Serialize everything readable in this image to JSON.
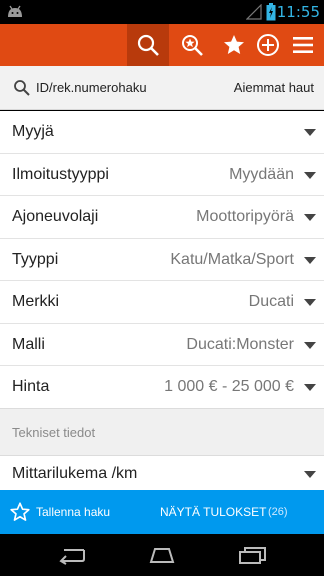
{
  "status_bar": {
    "time": "11:55",
    "accent": "#33b5e5"
  },
  "action_bar": {
    "color": "#e04a13",
    "icons": [
      "search-icon",
      "saved-search-icon",
      "star-icon",
      "add-icon",
      "menu-icon"
    ]
  },
  "search": {
    "id_label": "ID/rek.numerohaku",
    "previous_label": "Aiemmat haut"
  },
  "filters": [
    {
      "label": "Myyjä",
      "value": ""
    },
    {
      "label": "Ilmoitustyyppi",
      "value": "Myydään"
    },
    {
      "label": "Ajoneuvolaji",
      "value": "Moottoripyörä"
    },
    {
      "label": "Tyyppi",
      "value": "Katu/Matka/Sport"
    },
    {
      "label": "Merkki",
      "value": "Ducati"
    },
    {
      "label": "Malli",
      "value": "Ducati:Monster"
    },
    {
      "label": "Hinta",
      "value": "1 000 € - 25 000 €"
    }
  ],
  "technical": {
    "section_title": "Tekniset tiedot",
    "odometer_label": "Mittarilukema /km"
  },
  "bottom_bar": {
    "color": "#0099ee",
    "save_label": "Tallenna haku",
    "show_label": "NÄYTÄ TULOKSET",
    "count": "(26)"
  }
}
